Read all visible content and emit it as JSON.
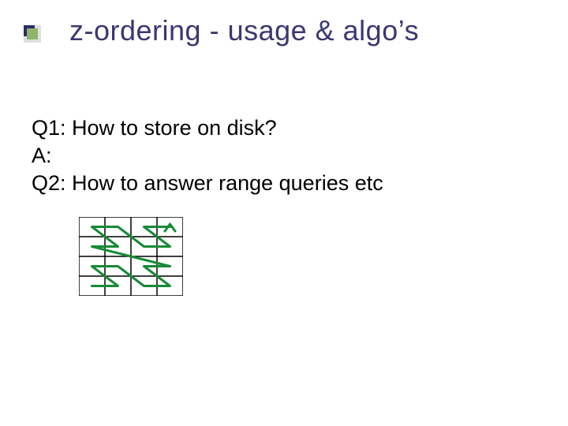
{
  "title": "z-ordering - usage & algo’s",
  "body": {
    "line1": "Q1: How to store on disk?",
    "line2": "A:",
    "line3": "Q2: How to answer range queries etc"
  },
  "colors": {
    "title": "#3a3772",
    "accent_outer": "#2e2c66",
    "accent_inner": "#8fb56a",
    "curve": "#178a36",
    "grid": "#000000"
  }
}
